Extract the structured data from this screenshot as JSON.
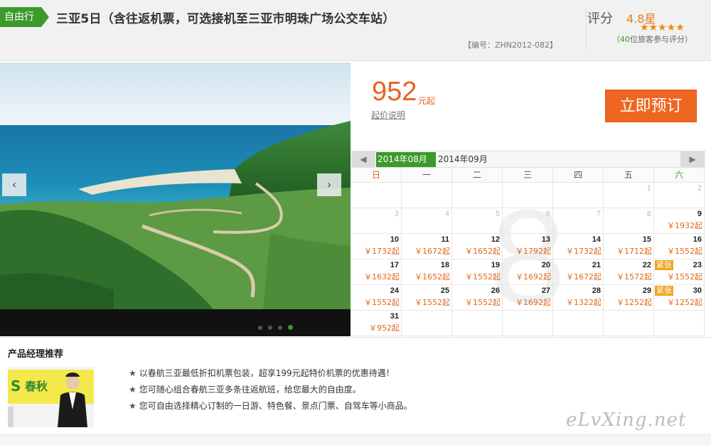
{
  "header": {
    "tag": "自由行",
    "title": "三亚5日（含往返机票，可选接机至三亚市明珠广场公交车站）",
    "code": "【编号：ZHN2012-082】",
    "rating_label": "评分",
    "rating_value": "4.8星",
    "stars": "★★★★★",
    "rating_count_prefix": "（",
    "rating_count_number": "40",
    "rating_count_suffix": "位旅客参与评分）"
  },
  "gallery": {
    "prev_icon": "‹",
    "next_icon": "›",
    "slide_count": 4,
    "active_slide": 4
  },
  "price_panel": {
    "price": "952",
    "unit": "元起",
    "note": "起价说明",
    "book_label": "立即预订"
  },
  "calendar": {
    "prev_icon": "◀",
    "next_icon": "▶",
    "current_month": "2014年08月",
    "next_month": "2014年09月",
    "big_month": "8",
    "weekdays": [
      "日",
      "一",
      "二",
      "三",
      "四",
      "五",
      "六"
    ],
    "cells": [
      {
        "day": "",
        "price": "",
        "avail": false,
        "tight": ""
      },
      {
        "day": "",
        "price": "",
        "avail": false,
        "tight": ""
      },
      {
        "day": "",
        "price": "",
        "avail": false,
        "tight": ""
      },
      {
        "day": "",
        "price": "",
        "avail": false,
        "tight": ""
      },
      {
        "day": "",
        "price": "",
        "avail": false,
        "tight": ""
      },
      {
        "day": "1",
        "price": "",
        "avail": false,
        "tight": ""
      },
      {
        "day": "2",
        "price": "",
        "avail": false,
        "tight": ""
      },
      {
        "day": "3",
        "price": "",
        "avail": false,
        "tight": ""
      },
      {
        "day": "4",
        "price": "",
        "avail": false,
        "tight": ""
      },
      {
        "day": "5",
        "price": "",
        "avail": false,
        "tight": ""
      },
      {
        "day": "6",
        "price": "",
        "avail": false,
        "tight": ""
      },
      {
        "day": "7",
        "price": "",
        "avail": false,
        "tight": ""
      },
      {
        "day": "8",
        "price": "",
        "avail": false,
        "tight": ""
      },
      {
        "day": "9",
        "price": "￥1932起",
        "avail": true,
        "tight": ""
      },
      {
        "day": "10",
        "price": "￥1732起",
        "avail": true,
        "tight": ""
      },
      {
        "day": "11",
        "price": "￥1672起",
        "avail": true,
        "tight": ""
      },
      {
        "day": "12",
        "price": "￥1652起",
        "avail": true,
        "tight": ""
      },
      {
        "day": "13",
        "price": "￥1792起",
        "avail": true,
        "tight": ""
      },
      {
        "day": "14",
        "price": "￥1732起",
        "avail": true,
        "tight": ""
      },
      {
        "day": "15",
        "price": "￥1712起",
        "avail": true,
        "tight": ""
      },
      {
        "day": "16",
        "price": "￥1552起",
        "avail": true,
        "tight": ""
      },
      {
        "day": "17",
        "price": "￥1632起",
        "avail": true,
        "tight": ""
      },
      {
        "day": "18",
        "price": "￥1652起",
        "avail": true,
        "tight": ""
      },
      {
        "day": "19",
        "price": "￥1552起",
        "avail": true,
        "tight": ""
      },
      {
        "day": "20",
        "price": "￥1692起",
        "avail": true,
        "tight": ""
      },
      {
        "day": "21",
        "price": "￥1672起",
        "avail": true,
        "tight": ""
      },
      {
        "day": "22",
        "price": "￥1572起",
        "avail": true,
        "tight": ""
      },
      {
        "day": "23",
        "price": "￥1552起",
        "avail": true,
        "tight": "紧张"
      },
      {
        "day": "24",
        "price": "￥1552起",
        "avail": true,
        "tight": ""
      },
      {
        "day": "25",
        "price": "￥1552起",
        "avail": true,
        "tight": ""
      },
      {
        "day": "26",
        "price": "￥1552起",
        "avail": true,
        "tight": ""
      },
      {
        "day": "27",
        "price": "￥1692起",
        "avail": true,
        "tight": ""
      },
      {
        "day": "28",
        "price": "￥1322起",
        "avail": true,
        "tight": ""
      },
      {
        "day": "29",
        "price": "￥1252起",
        "avail": true,
        "tight": ""
      },
      {
        "day": "30",
        "price": "￥1252起",
        "avail": true,
        "tight": "紧张"
      },
      {
        "day": "31",
        "price": "￥952起",
        "avail": true,
        "tight": ""
      },
      {
        "day": "",
        "price": "",
        "avail": false,
        "tight": ""
      },
      {
        "day": "",
        "price": "",
        "avail": false,
        "tight": ""
      },
      {
        "day": "",
        "price": "",
        "avail": false,
        "tight": ""
      },
      {
        "day": "",
        "price": "",
        "avail": false,
        "tight": ""
      },
      {
        "day": "",
        "price": "",
        "avail": false,
        "tight": ""
      },
      {
        "day": "",
        "price": "",
        "avail": false,
        "tight": ""
      }
    ]
  },
  "recommend": {
    "title": "产品经理推荐",
    "banner_text": "春秋",
    "items": [
      "以春航三亚最低折扣机票包装，超享199元起特价机票的优惠待遇！",
      "您可随心组合春航三亚多条往返航班，给您最大的自由度。",
      "您可自由选择精心订制的一日游、特色餐、景点门票、自驾车等小商品。"
    ],
    "star": "★"
  },
  "watermark": "eLvXing.net",
  "colors": {
    "green": "#3b9a2b",
    "orange": "#e8631e",
    "button": "#ee6622",
    "tight": "#f2a21e"
  }
}
